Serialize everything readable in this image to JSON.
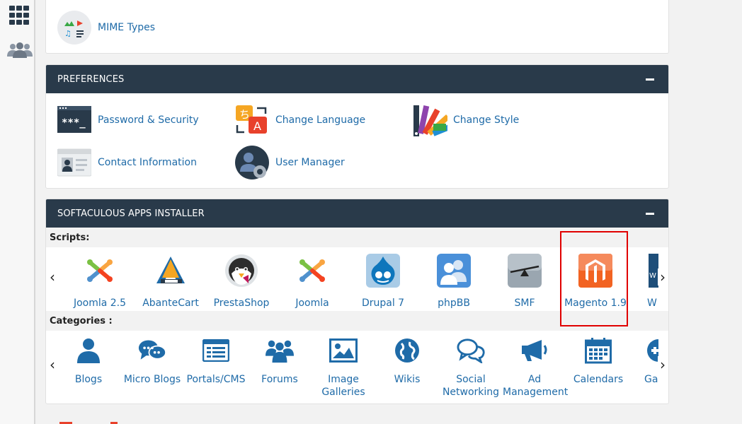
{
  "files_panel": {
    "items": [
      {
        "label": "MIME Types",
        "icon": "mime-types-icon"
      }
    ]
  },
  "preferences": {
    "title": "PREFERENCES",
    "items": [
      {
        "label": "Password & Security",
        "icon": "password-icon"
      },
      {
        "label": "Change Language",
        "icon": "language-icon"
      },
      {
        "label": "Change Style",
        "icon": "style-icon"
      },
      {
        "label": "Contact Information",
        "icon": "contact-icon"
      },
      {
        "label": "User Manager",
        "icon": "user-manager-icon"
      }
    ]
  },
  "softaculous": {
    "title": "SOFTACULOUS APPS INSTALLER",
    "scripts_label": "Scripts:",
    "categories_label": "Categories :",
    "scripts": [
      {
        "label": "Joomla 2.5"
      },
      {
        "label": "AbanteCart"
      },
      {
        "label": "PrestaShop"
      },
      {
        "label": "Joomla"
      },
      {
        "label": "Drupal 7"
      },
      {
        "label": "phpBB"
      },
      {
        "label": "SMF"
      },
      {
        "label": "Magento 1.9"
      },
      {
        "label": "W"
      }
    ],
    "categories": [
      {
        "label": "Blogs"
      },
      {
        "label": "Micro Blogs"
      },
      {
        "label": "Portals/CMS"
      },
      {
        "label": "Forums"
      },
      {
        "label": "Image Galleries"
      },
      {
        "label": "Wikis"
      },
      {
        "label": "Social Networking"
      },
      {
        "label": "Ad Management"
      },
      {
        "label": "Calendars"
      },
      {
        "label": "Ga"
      }
    ],
    "prev_arrow": "‹",
    "next_arrow": "›"
  },
  "colors": {
    "header_bg": "#293a4a",
    "link": "#1f6ba8",
    "highlight": "#e00000"
  }
}
